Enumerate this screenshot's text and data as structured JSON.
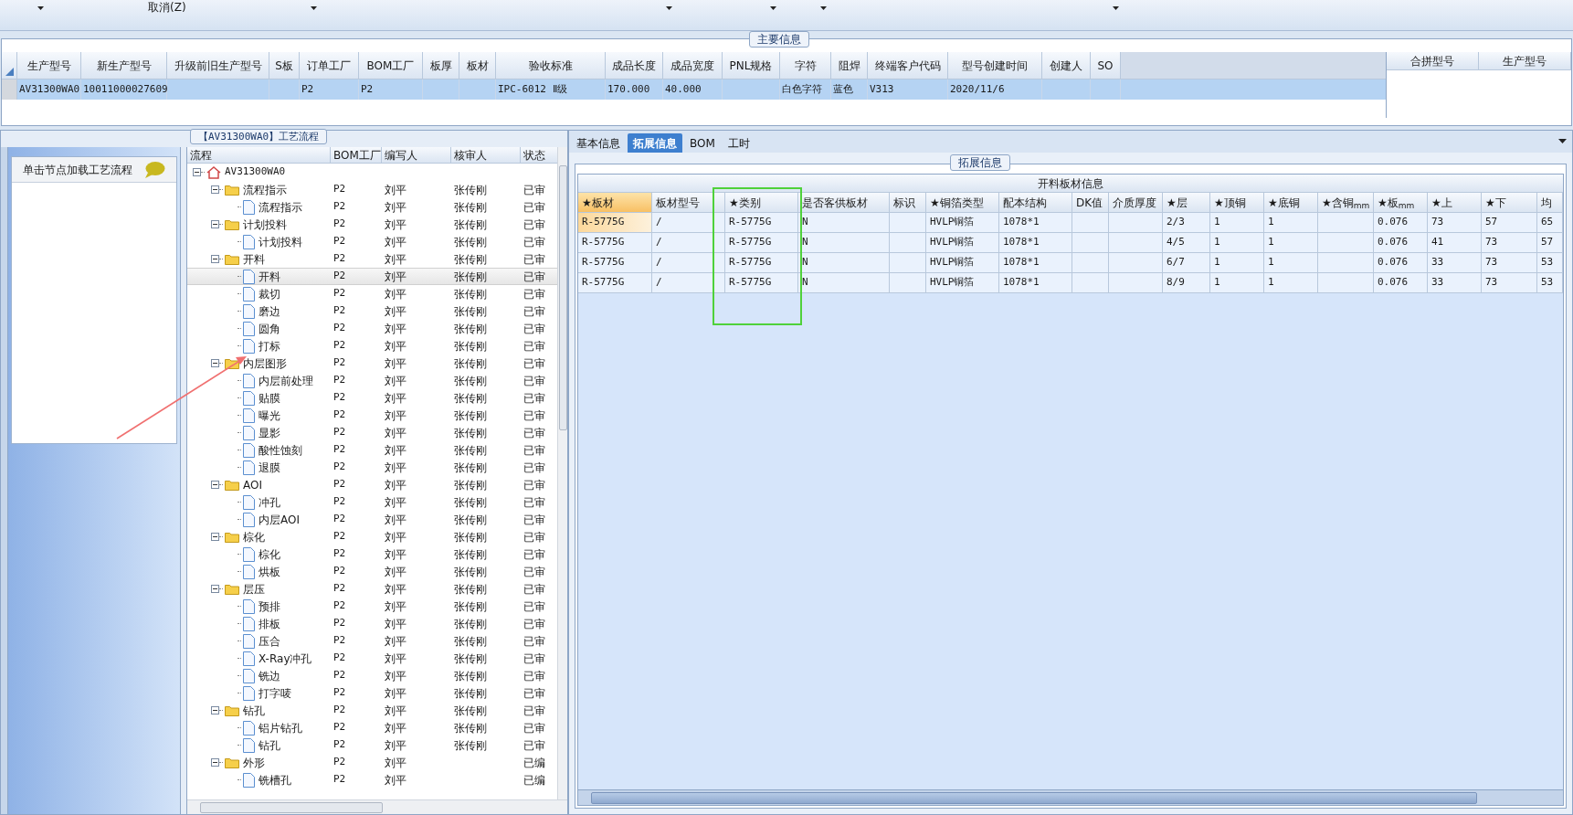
{
  "toolbar": {
    "cancel_label": "取消(Z)"
  },
  "main_info": {
    "title": "主要信息",
    "columns": [
      "生产型号",
      "新生产型号",
      "升级前旧生产型号",
      "S板",
      "订单工厂",
      "BOM工厂",
      "板厚",
      "板材",
      "验收标准",
      "成品长度",
      "成品宽度",
      "PNL规格",
      "字符",
      "阻焊",
      "终端客户代码",
      "型号创建时间",
      "创建人",
      "SO"
    ],
    "rows": [
      {
        "selected": true,
        "cells": [
          "AV31300WA0",
          "10011000027609",
          "",
          "",
          "P2",
          "P2",
          "",
          "",
          "IPC-6012 Ⅱ级",
          "170.000",
          "40.000",
          "",
          "白色字符",
          "蓝色",
          "V313",
          "2020/11/6",
          "",
          ""
        ]
      }
    ],
    "merge_columns": [
      "合拼型号",
      "生产型号"
    ]
  },
  "process_panel": {
    "title": "【AV31300WA0】工艺流程",
    "hint": "单击节点加载工艺流程",
    "columns": [
      "流程",
      "BOM工厂",
      "编写人",
      "核审人",
      "状态"
    ],
    "tree": [
      {
        "kind": "root",
        "label": "AV31300WA0",
        "expanded": true,
        "selected": false,
        "children": [
          {
            "kind": "folder",
            "label": "流程指示",
            "expanded": true,
            "selected": false,
            "bom": "P2",
            "writer": "刘平",
            "reviewer": "张传刚",
            "status": "已审",
            "children": [
              {
                "kind": "step",
                "label": "流程指示",
                "selected": false,
                "bom": "P2",
                "writer": "刘平",
                "reviewer": "张传刚",
                "status": "已审"
              }
            ]
          },
          {
            "kind": "folder",
            "label": "计划投料",
            "expanded": true,
            "selected": false,
            "bom": "P2",
            "writer": "刘平",
            "reviewer": "张传刚",
            "status": "已审",
            "children": [
              {
                "kind": "step",
                "label": "计划投料",
                "selected": false,
                "bom": "P2",
                "writer": "刘平",
                "reviewer": "张传刚",
                "status": "已审"
              }
            ]
          },
          {
            "kind": "folder",
            "label": "开料",
            "expanded": true,
            "selected": false,
            "bom": "P2",
            "writer": "刘平",
            "reviewer": "张传刚",
            "status": "已审",
            "children": [
              {
                "kind": "step",
                "label": "开料",
                "selected": true,
                "bom": "P2",
                "writer": "刘平",
                "reviewer": "张传刚",
                "status": "已审"
              },
              {
                "kind": "step",
                "label": "裁切",
                "selected": false,
                "bom": "P2",
                "writer": "刘平",
                "reviewer": "张传刚",
                "status": "已审"
              },
              {
                "kind": "step",
                "label": "磨边",
                "selected": false,
                "bom": "P2",
                "writer": "刘平",
                "reviewer": "张传刚",
                "status": "已审"
              },
              {
                "kind": "step",
                "label": "圆角",
                "selected": false,
                "bom": "P2",
                "writer": "刘平",
                "reviewer": "张传刚",
                "status": "已审"
              },
              {
                "kind": "step",
                "label": "打标",
                "selected": false,
                "bom": "P2",
                "writer": "刘平",
                "reviewer": "张传刚",
                "status": "已审"
              }
            ]
          },
          {
            "kind": "folder",
            "label": "内层图形",
            "expanded": true,
            "selected": false,
            "bom": "P2",
            "writer": "刘平",
            "reviewer": "张传刚",
            "status": "已审",
            "children": [
              {
                "kind": "step",
                "label": "内层前处理",
                "selected": false,
                "bom": "P2",
                "writer": "刘平",
                "reviewer": "张传刚",
                "status": "已审"
              },
              {
                "kind": "step",
                "label": "贴膜",
                "selected": false,
                "bom": "P2",
                "writer": "刘平",
                "reviewer": "张传刚",
                "status": "已审"
              },
              {
                "kind": "step",
                "label": "曝光",
                "selected": false,
                "bom": "P2",
                "writer": "刘平",
                "reviewer": "张传刚",
                "status": "已审"
              },
              {
                "kind": "step",
                "label": "显影",
                "selected": false,
                "bom": "P2",
                "writer": "刘平",
                "reviewer": "张传刚",
                "status": "已审"
              },
              {
                "kind": "step",
                "label": "酸性蚀刻",
                "selected": false,
                "bom": "P2",
                "writer": "刘平",
                "reviewer": "张传刚",
                "status": "已审"
              },
              {
                "kind": "step",
                "label": "退膜",
                "selected": false,
                "bom": "P2",
                "writer": "刘平",
                "reviewer": "张传刚",
                "status": "已审"
              }
            ]
          },
          {
            "kind": "folder",
            "label": "AOI",
            "expanded": true,
            "selected": false,
            "bom": "P2",
            "writer": "刘平",
            "reviewer": "张传刚",
            "status": "已审",
            "children": [
              {
                "kind": "step",
                "label": "冲孔",
                "selected": false,
                "bom": "P2",
                "writer": "刘平",
                "reviewer": "张传刚",
                "status": "已审"
              },
              {
                "kind": "step",
                "label": "内层AOI",
                "selected": false,
                "bom": "P2",
                "writer": "刘平",
                "reviewer": "张传刚",
                "status": "已审"
              }
            ]
          },
          {
            "kind": "folder",
            "label": "棕化",
            "expanded": true,
            "selected": false,
            "bom": "P2",
            "writer": "刘平",
            "reviewer": "张传刚",
            "status": "已审",
            "children": [
              {
                "kind": "step",
                "label": "棕化",
                "selected": false,
                "bom": "P2",
                "writer": "刘平",
                "reviewer": "张传刚",
                "status": "已审"
              },
              {
                "kind": "step",
                "label": "烘板",
                "selected": false,
                "bom": "P2",
                "writer": "刘平",
                "reviewer": "张传刚",
                "status": "已审"
              }
            ]
          },
          {
            "kind": "folder",
            "label": "层压",
            "expanded": true,
            "selected": false,
            "bom": "P2",
            "writer": "刘平",
            "reviewer": "张传刚",
            "status": "已审",
            "children": [
              {
                "kind": "step",
                "label": "预排",
                "selected": false,
                "bom": "P2",
                "writer": "刘平",
                "reviewer": "张传刚",
                "status": "已审"
              },
              {
                "kind": "step",
                "label": "排板",
                "selected": false,
                "bom": "P2",
                "writer": "刘平",
                "reviewer": "张传刚",
                "status": "已审"
              },
              {
                "kind": "step",
                "label": "压合",
                "selected": false,
                "bom": "P2",
                "writer": "刘平",
                "reviewer": "张传刚",
                "status": "已审"
              },
              {
                "kind": "step",
                "label": "X-Ray冲孔",
                "selected": false,
                "bom": "P2",
                "writer": "刘平",
                "reviewer": "张传刚",
                "status": "已审"
              },
              {
                "kind": "step",
                "label": "铣边",
                "selected": false,
                "bom": "P2",
                "writer": "刘平",
                "reviewer": "张传刚",
                "status": "已审"
              },
              {
                "kind": "step",
                "label": "打字唛",
                "selected": false,
                "bom": "P2",
                "writer": "刘平",
                "reviewer": "张传刚",
                "status": "已审"
              }
            ]
          },
          {
            "kind": "folder",
            "label": "钻孔",
            "expanded": true,
            "selected": false,
            "bom": "P2",
            "writer": "刘平",
            "reviewer": "张传刚",
            "status": "已审",
            "children": [
              {
                "kind": "step",
                "label": "铝片钻孔",
                "selected": false,
                "bom": "P2",
                "writer": "刘平",
                "reviewer": "张传刚",
                "status": "已审"
              },
              {
                "kind": "step",
                "label": "钻孔",
                "selected": false,
                "bom": "P2",
                "writer": "刘平",
                "reviewer": "张传刚",
                "status": "已审"
              }
            ]
          },
          {
            "kind": "folder",
            "label": "外形",
            "expanded": true,
            "selected": false,
            "bom": "P2",
            "writer": "刘平",
            "status": "已编",
            "children": [
              {
                "kind": "step",
                "label": "铣槽孔",
                "selected": false,
                "bom": "P2",
                "writer": "刘平",
                "status": "已编"
              }
            ]
          }
        ]
      }
    ]
  },
  "detail_panel": {
    "tabs": [
      {
        "label": "基本信息",
        "selected": false
      },
      {
        "label": "拓展信息",
        "selected": true
      },
      {
        "label": "BOM",
        "selected": false
      },
      {
        "label": "工时",
        "selected": false
      }
    ],
    "group_title": "拓展信息",
    "table_title": "开料板材信息",
    "columns": [
      {
        "label": "★板材",
        "selected": true
      },
      {
        "label": "板材型号",
        "selected": false
      },
      {
        "label": "★类别",
        "selected": false
      },
      {
        "label": "是否客供板材",
        "selected": false
      },
      {
        "label": "标识",
        "selected": false
      },
      {
        "label": "★铜箔类型",
        "selected": false
      },
      {
        "label": "配本结构",
        "selected": false
      },
      {
        "label": "DK值",
        "selected": false
      },
      {
        "label": "介质厚度",
        "selected": false
      },
      {
        "label": "★层",
        "selected": false
      },
      {
        "label": "★顶铜",
        "selected": false
      },
      {
        "label": "★底铜",
        "selected": false
      },
      {
        "label": "★含铜$_{mm}$",
        "selected": false
      },
      {
        "label": "★板$_{mm}$",
        "selected": false
      },
      {
        "label": "★上",
        "selected": false
      },
      {
        "label": "★下",
        "selected": false
      },
      {
        "label": "均",
        "selected": false
      }
    ],
    "rows": [
      {
        "selected": true,
        "cells": [
          "R-5775G",
          "/",
          "R-5775G",
          "N",
          "",
          "HVLP铜箔",
          "1078*1",
          "",
          "",
          "2/3",
          "1",
          "1",
          "",
          "0.076",
          "73",
          "57",
          "65"
        ]
      },
      {
        "selected": false,
        "cells": [
          "R-5775G",
          "/",
          "R-5775G",
          "N",
          "",
          "HVLP铜箔",
          "1078*1",
          "",
          "",
          "4/5",
          "1",
          "1",
          "",
          "0.076",
          "41",
          "73",
          "57"
        ]
      },
      {
        "selected": false,
        "cells": [
          "R-5775G",
          "/",
          "R-5775G",
          "N",
          "",
          "HVLP铜箔",
          "1078*1",
          "",
          "",
          "6/7",
          "1",
          "1",
          "",
          "0.076",
          "33",
          "73",
          "53"
        ]
      },
      {
        "selected": false,
        "cells": [
          "R-5775G",
          "/",
          "R-5775G",
          "N",
          "",
          "HVLP铜箔",
          "1078*1",
          "",
          "",
          "8/9",
          "1",
          "1",
          "",
          "0.076",
          "33",
          "73",
          "53"
        ]
      }
    ]
  }
}
